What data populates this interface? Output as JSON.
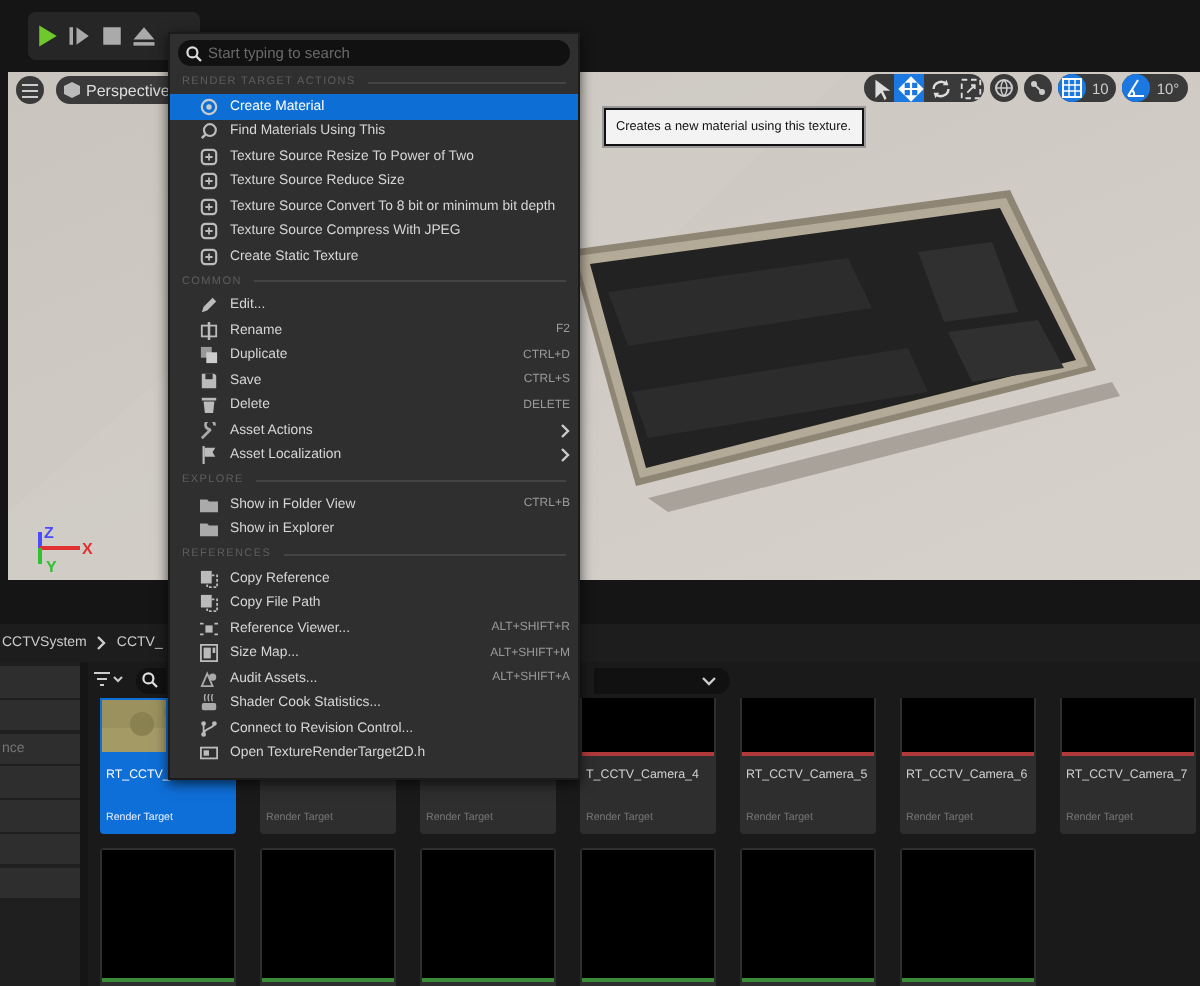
{
  "toolbar": {
    "play_controls": [
      {
        "kind": "play"
      },
      {
        "kind": "step"
      },
      {
        "kind": "stop"
      },
      {
        "kind": "eject"
      }
    ]
  },
  "viewport": {
    "view_mode": "Perspective",
    "transform_tools": [
      {
        "kind": "select",
        "selected": false
      },
      {
        "kind": "move",
        "selected": true
      },
      {
        "kind": "rotate",
        "selected": false
      },
      {
        "kind": "scale",
        "selected": false
      }
    ],
    "grid_snap": {
      "on": true,
      "value": "10"
    },
    "rotation_snap": {
      "on": true,
      "value": "10°"
    },
    "axis_labels": [
      {
        "label": "Z",
        "color": "#4a4aff"
      },
      {
        "label": "X",
        "color": "#e03030"
      },
      {
        "label": "Y",
        "color": "#30c030"
      }
    ]
  },
  "context_menu": {
    "search": {
      "placeholder": "Start typing to search"
    },
    "sections": [
      {
        "title": "RENDER TARGET ACTIONS",
        "items": [
          {
            "label": "Create Material",
            "selected": true
          },
          {
            "label": "Find Materials Using This",
            "selected": false
          },
          {
            "label": "Texture Source Resize To Power of Two",
            "selected": false
          },
          {
            "label": "Texture Source Reduce Size",
            "selected": false
          },
          {
            "label": "Texture Source Convert To 8 bit or minimum bit depth",
            "selected": false
          },
          {
            "label": "Texture Source Compress With JPEG",
            "selected": false
          },
          {
            "label": "Create Static Texture",
            "selected": false
          }
        ]
      },
      {
        "title": "COMMON",
        "items": [
          {
            "label": "Edit...",
            "selected": false
          },
          {
            "label": "Rename",
            "shortcut": "F2",
            "selected": false
          },
          {
            "label": "Duplicate",
            "shortcut": "CTRL+D",
            "selected": false
          },
          {
            "label": "Save",
            "shortcut": "CTRL+S",
            "selected": false
          },
          {
            "label": "Delete",
            "shortcut": "DELETE",
            "selected": false
          },
          {
            "label": "Asset Actions",
            "submenu": true,
            "selected": false
          },
          {
            "label": "Asset Localization",
            "submenu": true,
            "selected": false
          }
        ]
      },
      {
        "title": "EXPLORE",
        "items": [
          {
            "label": "Show in Folder View",
            "shortcut": "CTRL+B",
            "selected": false
          },
          {
            "label": "Show in Explorer",
            "selected": false
          }
        ]
      },
      {
        "title": "REFERENCES",
        "items": [
          {
            "label": "Copy Reference",
            "selected": false
          },
          {
            "label": "Copy File Path",
            "selected": false
          },
          {
            "label": "Reference Viewer...",
            "shortcut": "ALT+SHIFT+R",
            "selected": false
          },
          {
            "label": "Size Map...",
            "shortcut": "ALT+SHIFT+M",
            "selected": false
          },
          {
            "label": "Audit Assets...",
            "shortcut": "ALT+SHIFT+A",
            "selected": false
          },
          {
            "label": "Shader Cook Statistics...",
            "selected": false
          },
          {
            "label": "Connect to Revision Control...",
            "selected": false
          },
          {
            "label": "Open TextureRenderTarget2D.h",
            "selected": false
          }
        ]
      }
    ]
  },
  "tooltip": {
    "text": "Creates a new material using this texture."
  },
  "content_browser": {
    "breadcrumb": [
      "CCTVSystem",
      "CCTV_"
    ],
    "sidebar_label": "nce",
    "tiles": [
      {
        "kind": "textured",
        "name": "RT_CCTV_",
        "type": "Render Target",
        "selected": true
      },
      {
        "type": "Render Target",
        "selected": false
      },
      {
        "type": "Render Target",
        "selected": false
      },
      {
        "kind": "black",
        "color": "#b03a3a",
        "name": "T_CCTV_Camera_4",
        "type": "Render Target",
        "selected": false
      },
      {
        "kind": "black",
        "color": "#b03a3a",
        "name": "RT_CCTV_Camera_5",
        "type": "Render Target",
        "selected": false
      },
      {
        "kind": "black",
        "color": "#b03a3a",
        "name": "RT_CCTV_Camera_6",
        "type": "Render Target",
        "selected": false
      },
      {
        "kind": "black",
        "color": "#b03a3a",
        "name": "RT_CCTV_Camera_7",
        "type": "Render Target",
        "selected": false
      },
      {
        "kind": "black",
        "color": "#3a8a3a",
        "selected": false
      },
      {
        "kind": "black",
        "color": "#3a8a3a",
        "selected": false
      },
      {
        "kind": "black",
        "color": "#3a8a3a",
        "selected": false
      },
      {
        "kind": "black",
        "color": "#3a8a3a",
        "selected": false
      },
      {
        "kind": "black",
        "color": "#3a8a3a",
        "selected": false
      },
      {
        "kind": "black",
        "color": "#3a8a3a",
        "selected": false
      }
    ]
  }
}
